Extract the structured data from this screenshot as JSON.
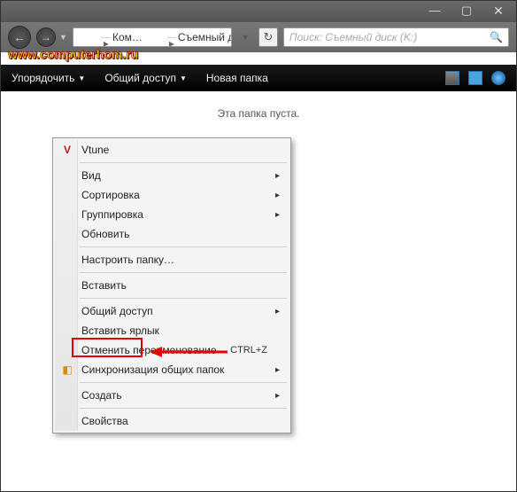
{
  "titlebar": {
    "min": "—",
    "max": "▢",
    "close": "✕"
  },
  "nav": {
    "back": "←",
    "forward": "→",
    "dropdown": "▼"
  },
  "breadcrumbs": {
    "seg1": "Ком…",
    "seg2": "Съемный д…",
    "sep": "▸"
  },
  "refresh_glyph": "↻",
  "search": {
    "placeholder": "Поиск: Съемный диск (K:)",
    "icon": "🔍"
  },
  "watermark": "www.computerhom.ru",
  "toolbar": {
    "organize": "Упорядочить",
    "share": "Общий доступ",
    "newfolder": "Новая папка",
    "dd": "▼"
  },
  "empty_text": "Эта папка пуста.",
  "menu": {
    "vtune": "Vtune",
    "view": "Вид",
    "sort": "Сортировка",
    "group": "Группировка",
    "refresh": "Обновить",
    "customize": "Настроить папку…",
    "paste": "Вставить",
    "share": "Общий доступ",
    "paste_shortcut": "Вставить ярлык",
    "undo_rename": "Отменить переименование",
    "undo_rename_key": "CTRL+Z",
    "sync": "Синхронизация общих папок",
    "create": "Создать",
    "properties": "Свойства",
    "arrow": "▸"
  },
  "icons": {
    "vtune_color": "#c01818",
    "sync_color": "#e08a00"
  }
}
